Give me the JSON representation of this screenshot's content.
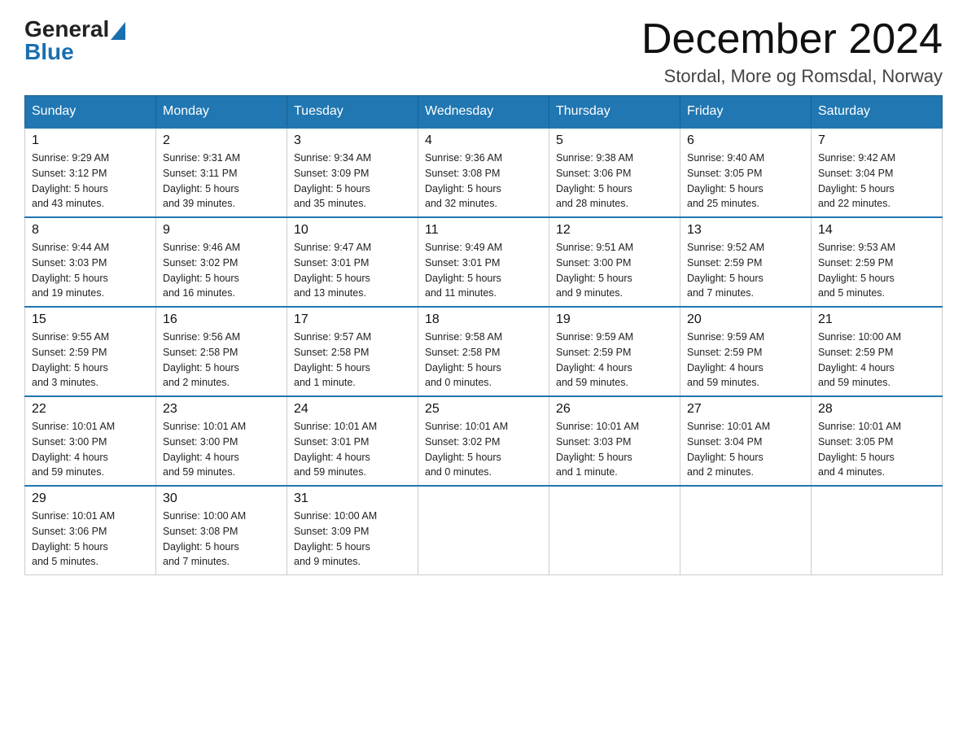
{
  "logo": {
    "general": "General",
    "blue": "Blue"
  },
  "header": {
    "month": "December 2024",
    "location": "Stordal, More og Romsdal, Norway"
  },
  "days_of_week": [
    "Sunday",
    "Monday",
    "Tuesday",
    "Wednesday",
    "Thursday",
    "Friday",
    "Saturday"
  ],
  "weeks": [
    [
      {
        "day": "1",
        "sunrise": "Sunrise: 9:29 AM",
        "sunset": "Sunset: 3:12 PM",
        "daylight": "Daylight: 5 hours",
        "daylight2": "and 43 minutes."
      },
      {
        "day": "2",
        "sunrise": "Sunrise: 9:31 AM",
        "sunset": "Sunset: 3:11 PM",
        "daylight": "Daylight: 5 hours",
        "daylight2": "and 39 minutes."
      },
      {
        "day": "3",
        "sunrise": "Sunrise: 9:34 AM",
        "sunset": "Sunset: 3:09 PM",
        "daylight": "Daylight: 5 hours",
        "daylight2": "and 35 minutes."
      },
      {
        "day": "4",
        "sunrise": "Sunrise: 9:36 AM",
        "sunset": "Sunset: 3:08 PM",
        "daylight": "Daylight: 5 hours",
        "daylight2": "and 32 minutes."
      },
      {
        "day": "5",
        "sunrise": "Sunrise: 9:38 AM",
        "sunset": "Sunset: 3:06 PM",
        "daylight": "Daylight: 5 hours",
        "daylight2": "and 28 minutes."
      },
      {
        "day": "6",
        "sunrise": "Sunrise: 9:40 AM",
        "sunset": "Sunset: 3:05 PM",
        "daylight": "Daylight: 5 hours",
        "daylight2": "and 25 minutes."
      },
      {
        "day": "7",
        "sunrise": "Sunrise: 9:42 AM",
        "sunset": "Sunset: 3:04 PM",
        "daylight": "Daylight: 5 hours",
        "daylight2": "and 22 minutes."
      }
    ],
    [
      {
        "day": "8",
        "sunrise": "Sunrise: 9:44 AM",
        "sunset": "Sunset: 3:03 PM",
        "daylight": "Daylight: 5 hours",
        "daylight2": "and 19 minutes."
      },
      {
        "day": "9",
        "sunrise": "Sunrise: 9:46 AM",
        "sunset": "Sunset: 3:02 PM",
        "daylight": "Daylight: 5 hours",
        "daylight2": "and 16 minutes."
      },
      {
        "day": "10",
        "sunrise": "Sunrise: 9:47 AM",
        "sunset": "Sunset: 3:01 PM",
        "daylight": "Daylight: 5 hours",
        "daylight2": "and 13 minutes."
      },
      {
        "day": "11",
        "sunrise": "Sunrise: 9:49 AM",
        "sunset": "Sunset: 3:01 PM",
        "daylight": "Daylight: 5 hours",
        "daylight2": "and 11 minutes."
      },
      {
        "day": "12",
        "sunrise": "Sunrise: 9:51 AM",
        "sunset": "Sunset: 3:00 PM",
        "daylight": "Daylight: 5 hours",
        "daylight2": "and 9 minutes."
      },
      {
        "day": "13",
        "sunrise": "Sunrise: 9:52 AM",
        "sunset": "Sunset: 2:59 PM",
        "daylight": "Daylight: 5 hours",
        "daylight2": "and 7 minutes."
      },
      {
        "day": "14",
        "sunrise": "Sunrise: 9:53 AM",
        "sunset": "Sunset: 2:59 PM",
        "daylight": "Daylight: 5 hours",
        "daylight2": "and 5 minutes."
      }
    ],
    [
      {
        "day": "15",
        "sunrise": "Sunrise: 9:55 AM",
        "sunset": "Sunset: 2:59 PM",
        "daylight": "Daylight: 5 hours",
        "daylight2": "and 3 minutes."
      },
      {
        "day": "16",
        "sunrise": "Sunrise: 9:56 AM",
        "sunset": "Sunset: 2:58 PM",
        "daylight": "Daylight: 5 hours",
        "daylight2": "and 2 minutes."
      },
      {
        "day": "17",
        "sunrise": "Sunrise: 9:57 AM",
        "sunset": "Sunset: 2:58 PM",
        "daylight": "Daylight: 5 hours",
        "daylight2": "and 1 minute."
      },
      {
        "day": "18",
        "sunrise": "Sunrise: 9:58 AM",
        "sunset": "Sunset: 2:58 PM",
        "daylight": "Daylight: 5 hours",
        "daylight2": "and 0 minutes."
      },
      {
        "day": "19",
        "sunrise": "Sunrise: 9:59 AM",
        "sunset": "Sunset: 2:59 PM",
        "daylight": "Daylight: 4 hours",
        "daylight2": "and 59 minutes."
      },
      {
        "day": "20",
        "sunrise": "Sunrise: 9:59 AM",
        "sunset": "Sunset: 2:59 PM",
        "daylight": "Daylight: 4 hours",
        "daylight2": "and 59 minutes."
      },
      {
        "day": "21",
        "sunrise": "Sunrise: 10:00 AM",
        "sunset": "Sunset: 2:59 PM",
        "daylight": "Daylight: 4 hours",
        "daylight2": "and 59 minutes."
      }
    ],
    [
      {
        "day": "22",
        "sunrise": "Sunrise: 10:01 AM",
        "sunset": "Sunset: 3:00 PM",
        "daylight": "Daylight: 4 hours",
        "daylight2": "and 59 minutes."
      },
      {
        "day": "23",
        "sunrise": "Sunrise: 10:01 AM",
        "sunset": "Sunset: 3:00 PM",
        "daylight": "Daylight: 4 hours",
        "daylight2": "and 59 minutes."
      },
      {
        "day": "24",
        "sunrise": "Sunrise: 10:01 AM",
        "sunset": "Sunset: 3:01 PM",
        "daylight": "Daylight: 4 hours",
        "daylight2": "and 59 minutes."
      },
      {
        "day": "25",
        "sunrise": "Sunrise: 10:01 AM",
        "sunset": "Sunset: 3:02 PM",
        "daylight": "Daylight: 5 hours",
        "daylight2": "and 0 minutes."
      },
      {
        "day": "26",
        "sunrise": "Sunrise: 10:01 AM",
        "sunset": "Sunset: 3:03 PM",
        "daylight": "Daylight: 5 hours",
        "daylight2": "and 1 minute."
      },
      {
        "day": "27",
        "sunrise": "Sunrise: 10:01 AM",
        "sunset": "Sunset: 3:04 PM",
        "daylight": "Daylight: 5 hours",
        "daylight2": "and 2 minutes."
      },
      {
        "day": "28",
        "sunrise": "Sunrise: 10:01 AM",
        "sunset": "Sunset: 3:05 PM",
        "daylight": "Daylight: 5 hours",
        "daylight2": "and 4 minutes."
      }
    ],
    [
      {
        "day": "29",
        "sunrise": "Sunrise: 10:01 AM",
        "sunset": "Sunset: 3:06 PM",
        "daylight": "Daylight: 5 hours",
        "daylight2": "and 5 minutes."
      },
      {
        "day": "30",
        "sunrise": "Sunrise: 10:00 AM",
        "sunset": "Sunset: 3:08 PM",
        "daylight": "Daylight: 5 hours",
        "daylight2": "and 7 minutes."
      },
      {
        "day": "31",
        "sunrise": "Sunrise: 10:00 AM",
        "sunset": "Sunset: 3:09 PM",
        "daylight": "Daylight: 5 hours",
        "daylight2": "and 9 minutes."
      },
      null,
      null,
      null,
      null
    ]
  ]
}
